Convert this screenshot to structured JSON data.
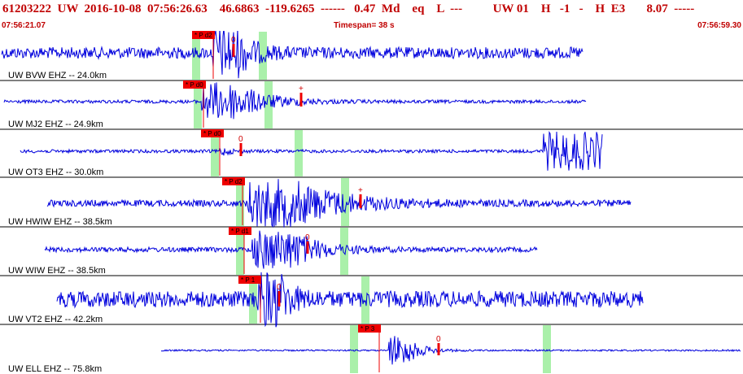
{
  "header": {
    "line": "61203222  UW  2016-10-08  07:56:26.63    46.6863  -119.6265  ------   0.47  Md    eq    L  ---          UW 01    H   -1   -    H  E3       8.07  -----",
    "start_time": "07:56:21.07",
    "timespan": "Timespan=  38 s",
    "end_time": "07:56:59.30"
  },
  "colors": {
    "trace": "#0000dd",
    "window": "#aaf0aa",
    "pick": "#ee0000",
    "text_red": "#c00000"
  },
  "channels": [
    {
      "label": "UW BVW EHZ -- 24.0km",
      "pick_label": "P d2",
      "pick_symbol": "*",
      "coda": "0"
    },
    {
      "label": "UW MJ2 EHZ -- 24.9km",
      "pick_label": "P d0",
      "pick_symbol": "*",
      "coda": "+"
    },
    {
      "label": "UW OT3 EHZ -- 30.0km",
      "pick_label": "P d0",
      "pick_symbol": "*",
      "coda": "0"
    },
    {
      "label": "UW HWIW EHZ -- 38.5km",
      "pick_label": "P d2",
      "pick_symbol": "*",
      "coda": "+"
    },
    {
      "label": "UW WIW EHZ -- 38.5km",
      "pick_label": "P d1",
      "pick_symbol": "*",
      "coda": "0"
    },
    {
      "label": "UW VT2 EHZ -- 42.2km",
      "pick_label": "P 1",
      "pick_symbol": "*",
      "coda": "0"
    },
    {
      "label": "UW ELL EHZ -- 75.8km",
      "pick_label": "P 3",
      "pick_symbol": "*",
      "coda": "0"
    }
  ]
}
